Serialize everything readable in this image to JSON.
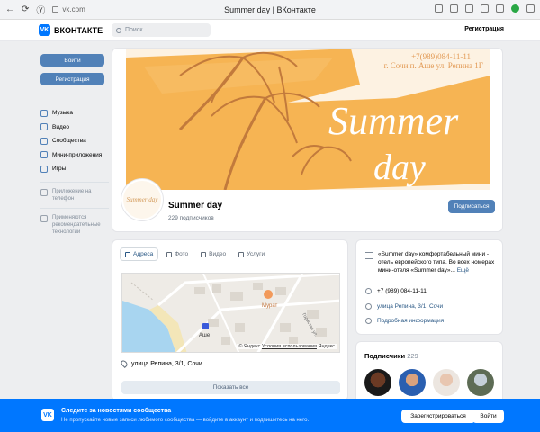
{
  "browser": {
    "url": "vk.com",
    "title": "Summer day | ВКонтакте"
  },
  "header": {
    "logo_text": "ВКОНТАКТЕ",
    "search_placeholder": "Поиск",
    "register_link": "Регистрация"
  },
  "sidebar": {
    "login_button": "Войти",
    "register_button": "Регистрация",
    "items": [
      {
        "label": "Музыка",
        "icon": "music-icon"
      },
      {
        "label": "Видео",
        "icon": "video-icon"
      },
      {
        "label": "Сообщества",
        "icon": "communities-icon"
      },
      {
        "label": "Мини-приложения",
        "icon": "apps-icon"
      },
      {
        "label": "Игры",
        "icon": "games-icon"
      }
    ],
    "phone_app": "Приложение на телефон",
    "recommend_note": "Применяются рекомендательные технологии"
  },
  "profile": {
    "cover_phone": "+7(989)084-11-11",
    "cover_address": "г. Сочи п. Аше ул. Репина 1Г",
    "cover_slogan_1": "Summer",
    "cover_slogan_2": "day",
    "avatar_text": "Summer day",
    "name": "Summer day",
    "subscribers": "229 подписчиков",
    "subscribe_button": "Подписаться"
  },
  "address_block": {
    "tabs": [
      {
        "label": "Адреса",
        "active": true
      },
      {
        "label": "Фото",
        "active": false
      },
      {
        "label": "Видео",
        "active": false
      },
      {
        "label": "Услуги",
        "active": false
      }
    ],
    "map_label_hotel": "Мурат",
    "map_label_place": "Аше",
    "map_street_label": "Гористая ул.",
    "map_caption_brand": "© Яндекс",
    "map_caption_terms": "Условия использования",
    "map_caption_logo": "Яндекс",
    "street": "улица Репина, 3/1, Сочи",
    "show_all_button": "Показать все"
  },
  "info": {
    "description": "«Summer day» комфортабельный мини - отель европейского типа. Во всех номерах мини-отеля «Summer day»...",
    "more_link": "Ещё",
    "phone": "+7 (989) 084-11-11",
    "address": "улица Репина, 3/1, Сочи",
    "details_link": "Подробная информация"
  },
  "subscribers_block": {
    "title": "Подписчики",
    "count": "229"
  },
  "banner": {
    "title": "Следите за новостями сообщества",
    "subtitle": "Не пропускайте новые записи любимого сообщества — войдите в аккаунт и подпишитесь на него.",
    "register_button": "Зарегистрироваться",
    "login_button": "Войти"
  },
  "colors": {
    "vk_blue": "#0077ff",
    "button_blue": "#5181b8",
    "cover_orange": "#f6b04b",
    "palm_brown": "#c27a3c"
  }
}
